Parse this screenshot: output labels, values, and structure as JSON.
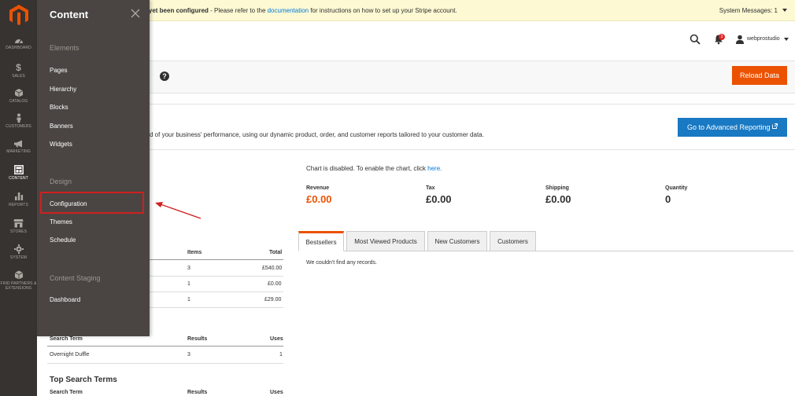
{
  "nav": {
    "items": [
      {
        "label": "DASHBOARD",
        "icon": "dashboard-icon"
      },
      {
        "label": "SALES",
        "icon": "dollar-icon"
      },
      {
        "label": "CATALOG",
        "icon": "box-icon"
      },
      {
        "label": "CUSTOMERS",
        "icon": "person-icon"
      },
      {
        "label": "MARKETING",
        "icon": "megaphone-icon"
      },
      {
        "label": "CONTENT",
        "icon": "layout-icon"
      },
      {
        "label": "REPORTS",
        "icon": "bar-chart-icon"
      },
      {
        "label": "STORES",
        "icon": "store-icon"
      },
      {
        "label": "SYSTEM",
        "icon": "gear-icon"
      },
      {
        "label": "FIND PARTNERS & EXTENSIONS",
        "icon": "cube-icon"
      }
    ]
  },
  "submenu": {
    "title": "Content",
    "groups": [
      {
        "label": "Elements",
        "links": [
          "Pages",
          "Hierarchy",
          "Blocks",
          "Banners",
          "Widgets"
        ]
      },
      {
        "label": "Design",
        "links": [
          "Configuration",
          "Themes",
          "Schedule"
        ]
      },
      {
        "label": "Content Staging",
        "links": [
          "Dashboard"
        ]
      }
    ]
  },
  "message": {
    "bold": "t yet been configured",
    "before_link": " - Please refer to the ",
    "link": "documentation",
    "after_link": " for instructions on how to set up your Stripe account.",
    "system": "System Messages: 1"
  },
  "header": {
    "username": "webprostudio",
    "notifications": "3"
  },
  "actions": {
    "reload": "Reload Data",
    "advanced": "Go to Advanced Reporting",
    "help": "?"
  },
  "intro": "d of your business' performance, using our dynamic product, order, and customer reports tailored to your customer data.",
  "chart_note": {
    "text": "Chart is disabled. To enable the chart, click ",
    "link": "here."
  },
  "stats": [
    {
      "label": "Revenue",
      "value": "£0.00"
    },
    {
      "label": "Tax",
      "value": "£0.00"
    },
    {
      "label": "Shipping",
      "value": "£0.00"
    },
    {
      "label": "Quantity",
      "value": "0"
    }
  ],
  "tabs": [
    "Bestsellers",
    "Most Viewed Products",
    "New Customers",
    "Customers"
  ],
  "no_records": "We couldn't find any records.",
  "orders_table": {
    "headers": [
      "Items",
      "Total"
    ],
    "rows": [
      {
        "items": "3",
        "total": "£540.00"
      },
      {
        "items": "1",
        "total": "£0.00"
      },
      {
        "items": "1",
        "total": "£29.00"
      }
    ]
  },
  "search_table": {
    "headers": [
      "Search Term",
      "Results",
      "Uses"
    ],
    "rows": [
      {
        "term": "Overnight Duffle",
        "results": "3",
        "uses": "1"
      }
    ]
  },
  "top_search": {
    "title": "Top Search Terms",
    "headers": [
      "Search Term",
      "Results",
      "Uses"
    ]
  },
  "colors": {
    "accent": "#eb5202",
    "primary": "#1979c3",
    "nav_bg": "#373330",
    "submenu_bg": "#4a4542",
    "highlight": "#d01f1f"
  }
}
